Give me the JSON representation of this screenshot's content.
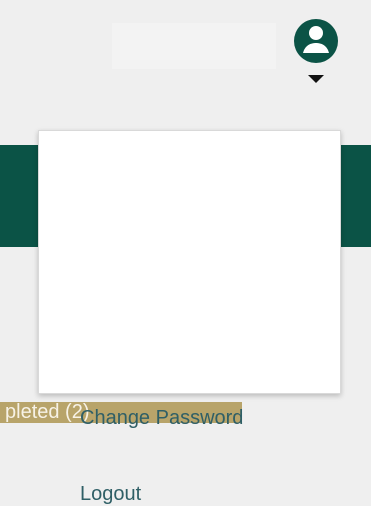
{
  "header": {
    "user_icon": "user-avatar-icon",
    "caret_icon": "caret-down-icon",
    "accent_color": "#0b5346"
  },
  "menu": {
    "items": [
      {
        "label": "Change Password"
      },
      {
        "label": "Logout"
      }
    ]
  },
  "tabs": {
    "completed_label": "pleted (2)"
  },
  "colors": {
    "background": "#efefef",
    "band": "#0b5346",
    "tab": "#b8a46a",
    "menu_text": "#2f5f66"
  }
}
